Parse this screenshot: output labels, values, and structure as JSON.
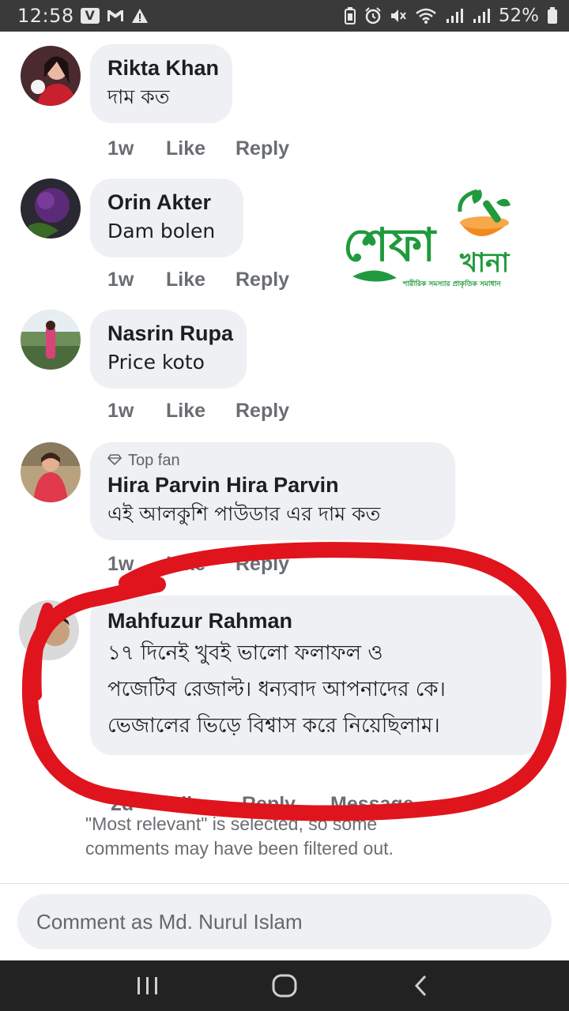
{
  "status_bar": {
    "time": "12:58",
    "battery": "52%",
    "left_icons": [
      "v-app-icon",
      "gmail-icon",
      "warning-icon"
    ],
    "right_icons": [
      "battery-saver-icon",
      "alarm-icon",
      "mute-icon",
      "wifi-icon",
      "signal-icon",
      "signal-icon"
    ]
  },
  "comments": [
    {
      "name": "Rikta Khan",
      "text": "দাম কত",
      "time": "1w",
      "like": "Like",
      "reply": "Reply"
    },
    {
      "name": "Orin Akter",
      "text": "Dam bolen",
      "time": "1w",
      "like": "Like",
      "reply": "Reply"
    },
    {
      "name": "Nasrin Rupa",
      "text": "Price koto",
      "time": "1w",
      "like": "Like",
      "reply": "Reply"
    },
    {
      "badge": "Top fan",
      "name": "Hira Parvin Hira Parvin",
      "text": "এই আলকুশি পাউডার এর দাম কত",
      "time": "1w",
      "like": "Like",
      "reply": "Reply"
    },
    {
      "name": "Mahfuzur Rahman",
      "lines": [
        "১৭ দিনেই খুবই ভালো ফলাফল ও",
        "পজেটিব রেজাল্ট। ধন্যবাদ আপনাদের কে।",
        "ভেজালের ভিড়ে বিশ্বাস করে নিয়েছিলাম।"
      ],
      "time": "2d",
      "like": "Like",
      "reply": "Reply",
      "message": "Message"
    }
  ],
  "filter_note": [
    "\"Most relevant\" is selected, so some",
    "comments may have been filtered out."
  ],
  "composer": {
    "placeholder": "Comment as Md. Nurul Islam"
  },
  "logo": {
    "title_part1": "শেফা",
    "title_part2": "খানা",
    "tagline": "শারীরিক সমস্যার প্রাকৃতিক সমাধান"
  },
  "colors": {
    "logo_green": "#1f9a3c",
    "logo_orange": "#f08a1e",
    "marker_red": "#e0141d",
    "bubble_bg": "#eff0f3",
    "meta_gray": "#6a6d72"
  }
}
